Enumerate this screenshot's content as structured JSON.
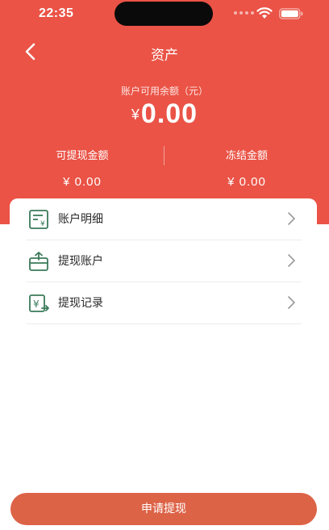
{
  "status_bar": {
    "time": "22:35"
  },
  "nav": {
    "title": "资产"
  },
  "balance": {
    "label": "账户可用余额（元）",
    "currency": "¥",
    "amount": "0.00"
  },
  "sub_balances": [
    {
      "label": "可提现金额",
      "value": "¥ 0.00"
    },
    {
      "label": "冻结金额",
      "value": "¥ 0.00"
    }
  ],
  "menu": [
    {
      "label": "账户明细",
      "icon": "ledger-icon"
    },
    {
      "label": "提现账户",
      "icon": "wallet-card-icon"
    },
    {
      "label": "提现记录",
      "icon": "yuan-record-icon"
    }
  ],
  "footer": {
    "button_label": "申请提现"
  },
  "colors": {
    "header": "#ea5346",
    "button": "#dd6347",
    "icon_green": "#3a7a5a"
  }
}
